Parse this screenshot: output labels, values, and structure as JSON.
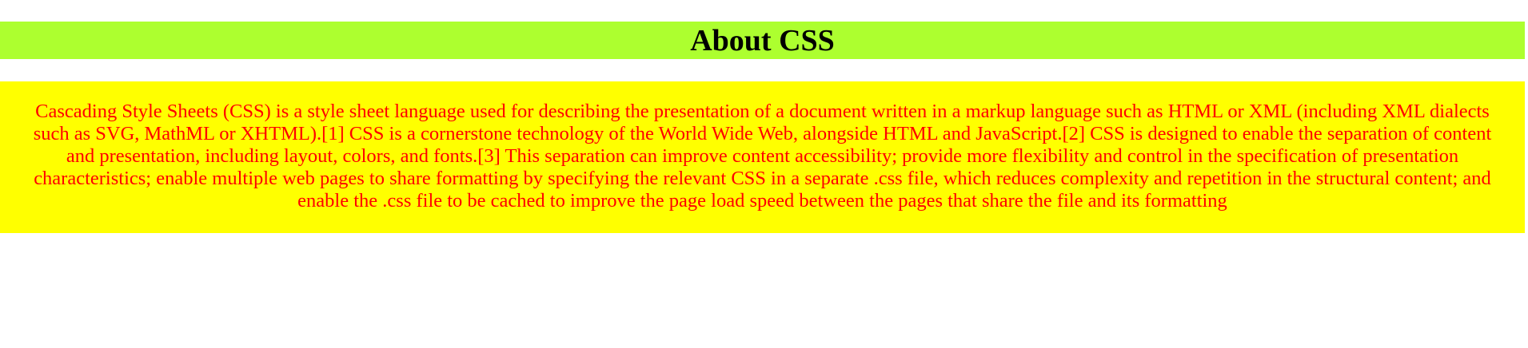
{
  "header": {
    "title": "About CSS"
  },
  "content": {
    "paragraph": "Cascading Style Sheets (CSS) is a style sheet language used for describing the presentation of a document written in a markup language such as HTML or XML (including XML dialects such as SVG, MathML or XHTML).[1] CSS is a cornerstone technology of the World Wide Web, alongside HTML and JavaScript.[2] CSS is designed to enable the separation of content and presentation, including layout, colors, and fonts.[3] This separation can improve content accessibility; provide more flexibility and control in the specification of presentation characteristics; enable multiple web pages to share formatting by specifying the relevant CSS in a separate .css file, which reduces complexity and repetition in the structural content; and enable the .css file to be cached to improve the page load speed between the pages that share the file and its formatting"
  },
  "colors": {
    "title_background": "#adff2f",
    "title_text": "#000000",
    "content_background": "#ffff00",
    "content_text": "#ff0000",
    "page_background": "#ffffff"
  }
}
